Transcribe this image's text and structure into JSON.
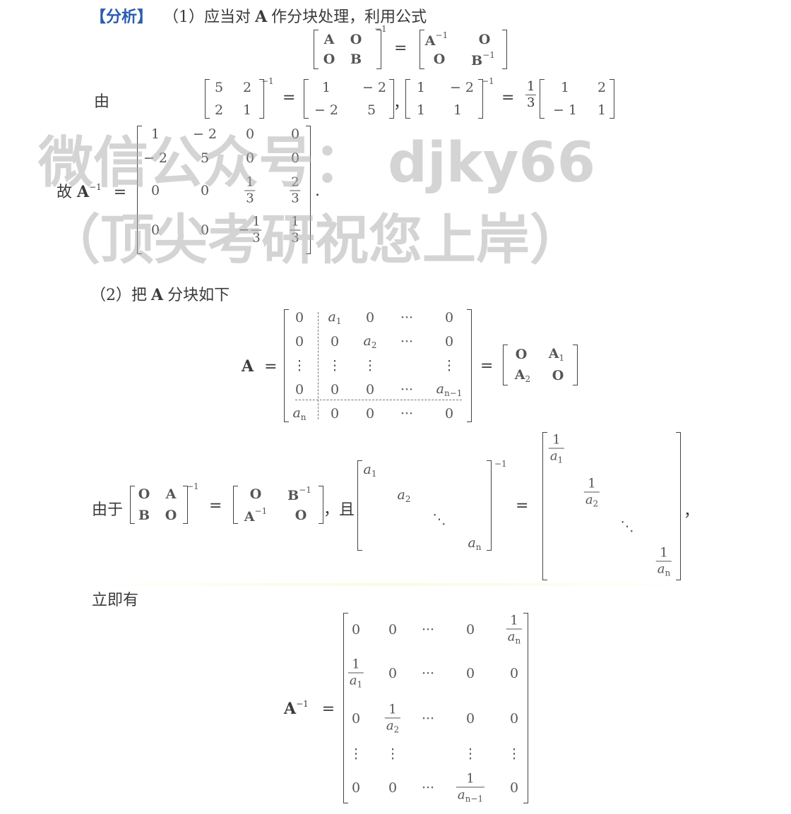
{
  "tag": {
    "open": "【",
    "text": "分析",
    "close": "】"
  },
  "part1": {
    "num": "（1）",
    "text_before": "应当对",
    "sym": "A",
    "text_after": "作分块处理，利用公式"
  },
  "formula1": {
    "lhs": [
      "A",
      "O",
      "O",
      "B"
    ],
    "inv": "−1",
    "eq": "=",
    "rhs": [
      "A",
      "O",
      "O",
      "B"
    ],
    "rhs_sup": "−1"
  },
  "you_label": "由",
  "ex1": {
    "m1": [
      "5",
      "2",
      "2",
      "1"
    ],
    "inv": "−1",
    "eq": "=",
    "m2": [
      "1",
      "− 2",
      "− 2",
      "5"
    ],
    "dot": "，",
    "m3": [
      "1",
      "− 2",
      "1",
      "1"
    ],
    "eq2": "=",
    "coef_num": "1",
    "coef_den": "3",
    "m4": [
      "1",
      "2",
      "− 1",
      "1"
    ]
  },
  "gu": {
    "label": "故",
    "sym": "A",
    "sup": "−1",
    "eq": "=",
    "period": "."
  },
  "ainv4": {
    "rows": [
      [
        "1",
        "− 2",
        "0",
        "0"
      ],
      [
        "− 2",
        "5",
        "0",
        "0"
      ],
      [
        "0",
        "0",
        "1/3",
        "2/3"
      ],
      [
        "0",
        "0",
        "−1/3",
        "1/3"
      ]
    ]
  },
  "watermark": {
    "line1": "微信公众号： djky66",
    "line2": "（顶尖考研祝您上岸）"
  },
  "part2": {
    "num": "（2）",
    "text_before": "把",
    "sym": "A",
    "text_after": "分块如下"
  },
  "blockA": {
    "sym": "A",
    "eq": "=",
    "rows": [
      [
        "0",
        "a|1",
        "0",
        "···",
        "0"
      ],
      [
        "0",
        "0",
        "a|2",
        "···",
        "0"
      ],
      [
        "⋮",
        "⋮",
        "⋮",
        "",
        "⋮"
      ],
      [
        "0",
        "0",
        "0",
        "···",
        "a|n−1"
      ],
      [
        "a|n",
        "0",
        "0",
        "···",
        "0"
      ]
    ],
    "eq2": "=",
    "block": [
      "O",
      "A|1",
      "A|2",
      "O"
    ]
  },
  "youyu": {
    "label": "由于",
    "m1": [
      "O",
      "A",
      "B",
      "O"
    ],
    "inv": "−1",
    "eq": "=",
    "m2": [
      "O",
      "B",
      "A",
      "O"
    ],
    "m2_sup": "−1",
    "qie": "，且",
    "diag": [
      "a|1",
      "a|2",
      "⋱",
      "a|n"
    ],
    "diag_inv": "−1",
    "eq2": "=",
    "diaginv": [
      "1/a|1",
      "1/a|2",
      "⋱",
      "1/a|n"
    ],
    "comma": "，"
  },
  "liji": "立即有",
  "final": {
    "sym": "A",
    "sup": "−1",
    "eq": "=",
    "rows": [
      [
        "0",
        "0",
        "···",
        "0",
        "1/a|n"
      ],
      [
        "1/a|1",
        "0",
        "···",
        "0",
        "0"
      ],
      [
        "0",
        "1/a|2",
        "···",
        "0",
        "0"
      ],
      [
        "⋮",
        "⋮",
        "",
        "⋮",
        "⋮"
      ],
      [
        "0",
        "0",
        "···",
        "1/a|n−1",
        "0"
      ]
    ]
  }
}
